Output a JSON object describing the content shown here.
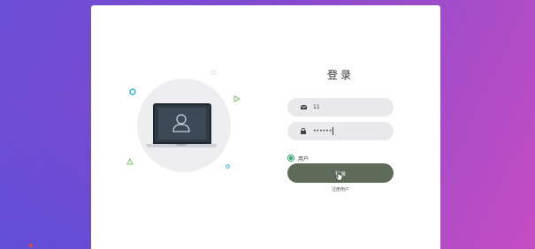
{
  "colors": {
    "background_gradient": [
      "#6a4fd6",
      "#c54cc2"
    ],
    "card": "#ffffff",
    "input_bg": "#e9e9ec",
    "button": "#5e6b58",
    "radio_accent": "#2aa36b",
    "deco_cyan": "#2bb5d8",
    "deco_green": "#77c26a"
  },
  "login": {
    "title": "登录",
    "username": {
      "value": "11",
      "icon": "envelope-icon"
    },
    "password": {
      "value": "••••••",
      "icon": "lock-icon"
    },
    "role": {
      "label": "用户",
      "selected": true
    },
    "submit_label": "登录",
    "register_label": "注册用户"
  },
  "illustration": {
    "icon": "laptop-user-icon"
  }
}
